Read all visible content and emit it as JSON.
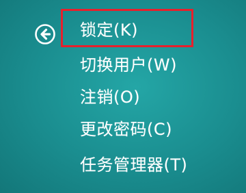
{
  "colors": {
    "background": "#1a8d8f",
    "text": "#ffffff",
    "highlight_border": "#e8202c"
  },
  "back_button": {
    "icon": "circle-arrow-left-icon"
  },
  "menu": {
    "items": [
      {
        "label": "锁定(K)",
        "selected": true
      },
      {
        "label": "切换用户(W)"
      },
      {
        "label": "注销(O)"
      },
      {
        "label": "更改密码(C)"
      },
      {
        "label": "任务管理器(T)"
      }
    ]
  }
}
